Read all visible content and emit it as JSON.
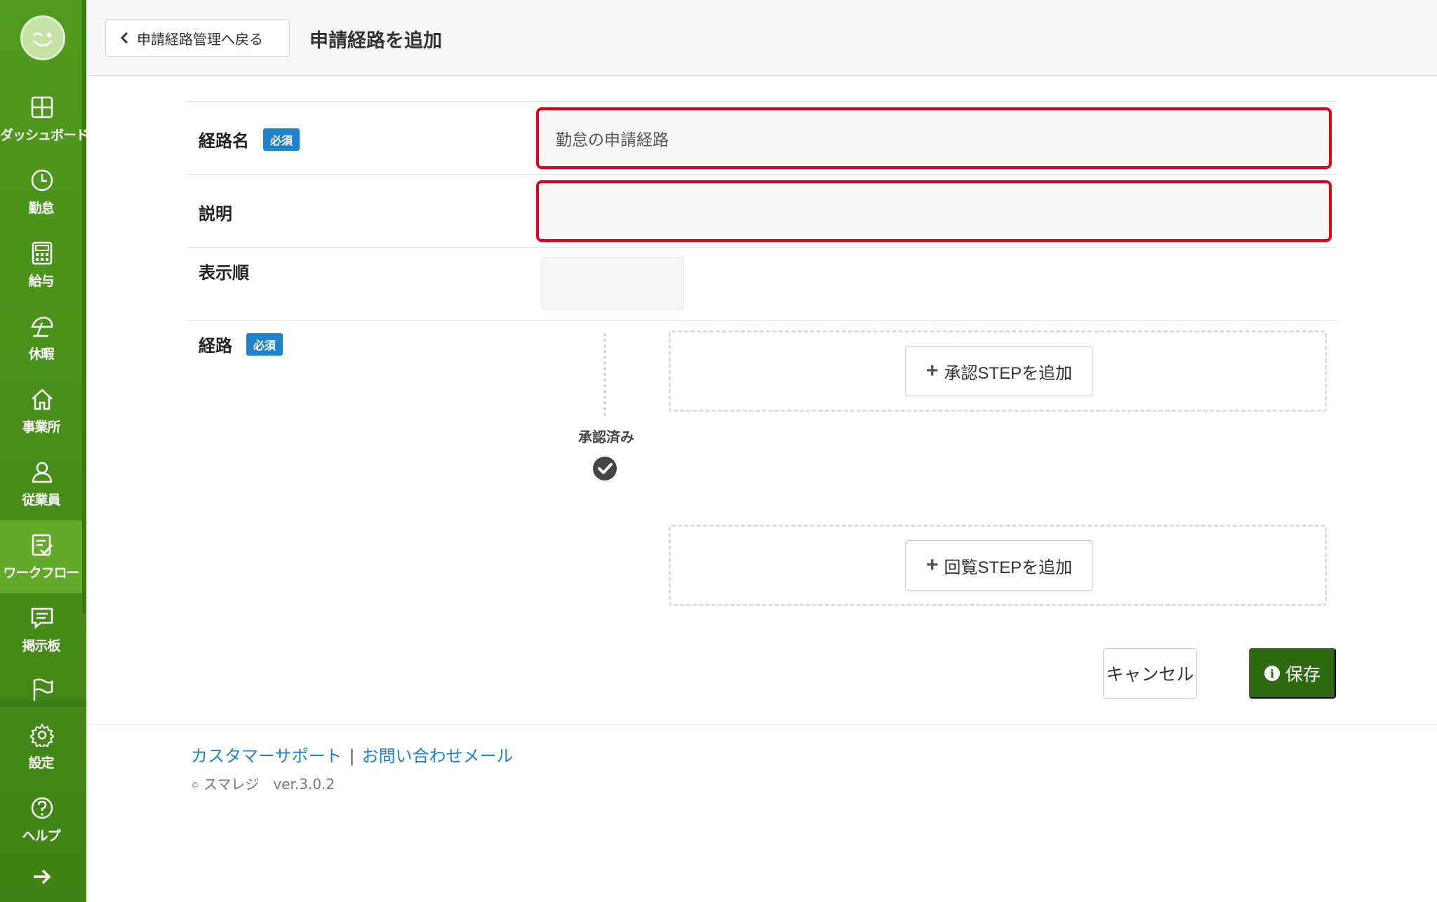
{
  "sidebar": {
    "items": [
      {
        "label": "ダッシュボード",
        "icon": "dashboard-icon"
      },
      {
        "label": "勤怠",
        "icon": "clock-icon"
      },
      {
        "label": "給与",
        "icon": "calculator-icon"
      },
      {
        "label": "休暇",
        "icon": "umbrella-icon"
      },
      {
        "label": "事業所",
        "icon": "home-icon"
      },
      {
        "label": "従業員",
        "icon": "person-icon"
      },
      {
        "label": "ワークフロー",
        "icon": "clipboard-check-icon",
        "active": true
      },
      {
        "label": "掲示板",
        "icon": "chat-icon"
      },
      {
        "label": "",
        "icon": "flag-icon"
      },
      {
        "label": "設定",
        "icon": "gear-icon"
      },
      {
        "label": "ヘルプ",
        "icon": "help-icon"
      }
    ],
    "accent_color": "#4f9a1e"
  },
  "header": {
    "back_label": "申請経路管理へ戻る",
    "title": "申請経路を追加"
  },
  "form": {
    "route_name": {
      "label": "経路名",
      "badge": "必須",
      "value": "勤怠の申請経路"
    },
    "description": {
      "label": "説明",
      "value": ""
    },
    "display_order": {
      "label": "表示順",
      "value": ""
    },
    "route": {
      "label": "経路",
      "badge": "必須",
      "approved_label": "承認済み",
      "add_approval_step": "承認STEPを追加",
      "add_review_step": "回覧STEPを追加"
    },
    "cancel_label": "キャンセル",
    "save_label": "保存",
    "error_color": "#e4001a",
    "save_color": "#2e6b10"
  },
  "footer": {
    "support_link": "カスタマーサポート",
    "separator": "|",
    "contact_link": "お問い合わせメール",
    "copyright_symbol": "©",
    "copyright": "スマレジ　ver.3.0.2"
  }
}
